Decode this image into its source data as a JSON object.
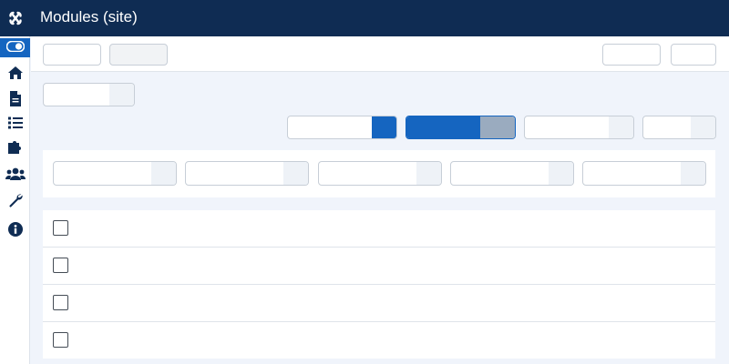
{
  "header": {
    "title": "Modules (site)",
    "logo_icon": "joomla-logo-icon"
  },
  "colors": {
    "header_bg": "#0f2c53",
    "accent": "#1565c0",
    "page_bg": "#f0f4fb"
  },
  "sidebar": {
    "items": [
      {
        "icon": "toggle-menu-icon",
        "active": true
      },
      {
        "icon": "home-icon"
      },
      {
        "icon": "file-icon"
      },
      {
        "icon": "list-icon"
      },
      {
        "icon": "puzzle-icon"
      },
      {
        "icon": "users-icon"
      },
      {
        "icon": "wrench-icon"
      },
      {
        "icon": "info-icon"
      }
    ]
  },
  "list": {
    "row_count": 4
  }
}
